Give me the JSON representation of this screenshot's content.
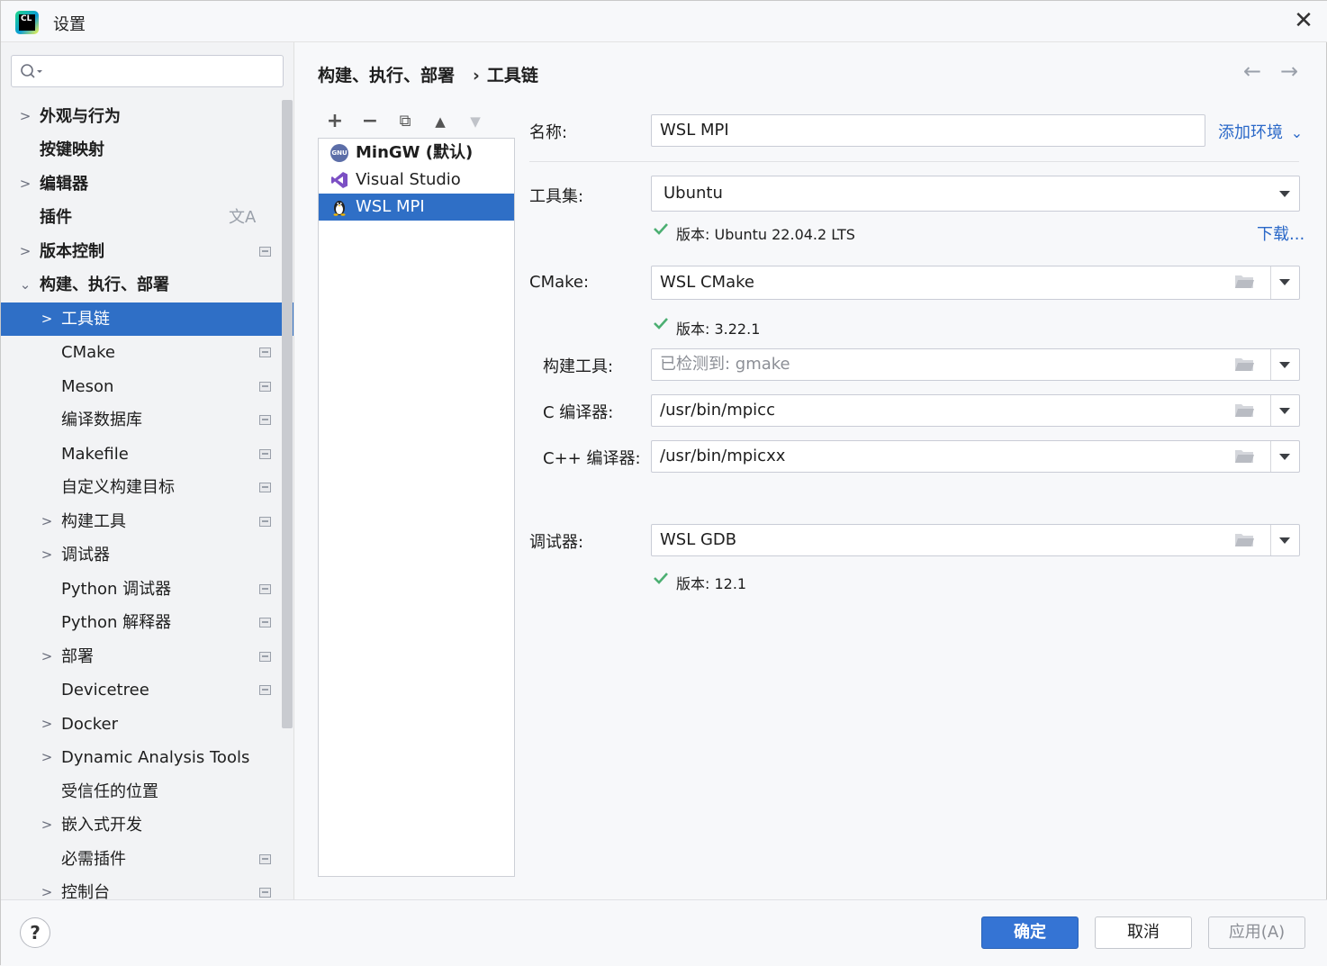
{
  "window": {
    "title": "设置",
    "app_logo_text": "CL"
  },
  "search": {
    "placeholder": ""
  },
  "sidebar": {
    "items": [
      {
        "label": "外观与行为",
        "chevron": ">"
      },
      {
        "label": "按键映射"
      },
      {
        "label": "编辑器",
        "chevron": ">"
      },
      {
        "label": "插件",
        "icon": "文A"
      },
      {
        "label": "版本控制",
        "chevron": ">"
      },
      {
        "label": "构建、执行、部署",
        "chevron": "v"
      },
      {
        "label": "工具链",
        "chevron": ">"
      },
      {
        "label": "CMake"
      },
      {
        "label": "Meson"
      },
      {
        "label": "编译数据库"
      },
      {
        "label": "Makefile"
      },
      {
        "label": "自定义构建目标"
      },
      {
        "label": "构建工具",
        "chevron": ">"
      },
      {
        "label": "调试器",
        "chevron": ">"
      },
      {
        "label": "Python 调试器"
      },
      {
        "label": "Python 解释器"
      },
      {
        "label": "部署",
        "chevron": ">"
      },
      {
        "label": "Devicetree"
      },
      {
        "label": "Docker",
        "chevron": ">"
      },
      {
        "label": "Dynamic Analysis Tools",
        "chevron": ">"
      },
      {
        "label": "受信任的位置"
      },
      {
        "label": "嵌入式开发",
        "chevron": ">"
      },
      {
        "label": "必需插件"
      },
      {
        "label": "控制台",
        "chevron": ">"
      }
    ]
  },
  "breadcrumb": {
    "parent": "构建、执行、部署",
    "separator": "›",
    "current": "工具链"
  },
  "nav": {
    "back": "←",
    "forward": "→"
  },
  "toolchain_toolbar": {
    "add": "+",
    "remove": "−",
    "copy": "⧉",
    "up": "▲",
    "down": "▼"
  },
  "toolchains": [
    {
      "name": "MinGW (默认)",
      "icon": "gnu-icon",
      "icon_text": "GNU"
    },
    {
      "name": "Visual Studio",
      "icon": "visual-studio-icon"
    },
    {
      "name": "WSL MPI",
      "icon": "linux-penguin-icon"
    }
  ],
  "form": {
    "name_label": "名称:",
    "name_value": "WSL MPI",
    "add_env_link": "添加环境",
    "add_env_chevron": "⌄",
    "toolset_label": "工具集:",
    "toolset_value": "Ubuntu",
    "toolset_version": "版本: Ubuntu 22.04.2 LTS",
    "download_link": "下载...",
    "cmake_label": "CMake:",
    "cmake_value": "WSL CMake",
    "cmake_version": "版本: 3.22.1",
    "build_tool_label": "构建工具:",
    "build_tool_value": "已检测到: gmake",
    "c_compiler_label": "C 编译器:",
    "c_compiler_value": "/usr/bin/mpicc",
    "cpp_compiler_label": "C++ 编译器:",
    "cpp_compiler_value": "/usr/bin/mpicxx",
    "debugger_label": "调试器:",
    "debugger_value": "WSL GDB",
    "debugger_version": "版本: 12.1"
  },
  "buttons": {
    "help": "?",
    "ok": "确定",
    "cancel": "取消",
    "apply": "应用(A)"
  },
  "colors": {
    "accent": "#2f6fc6",
    "primary_button": "#3574d4",
    "link": "#2a68c8",
    "check": "#4caf72"
  }
}
